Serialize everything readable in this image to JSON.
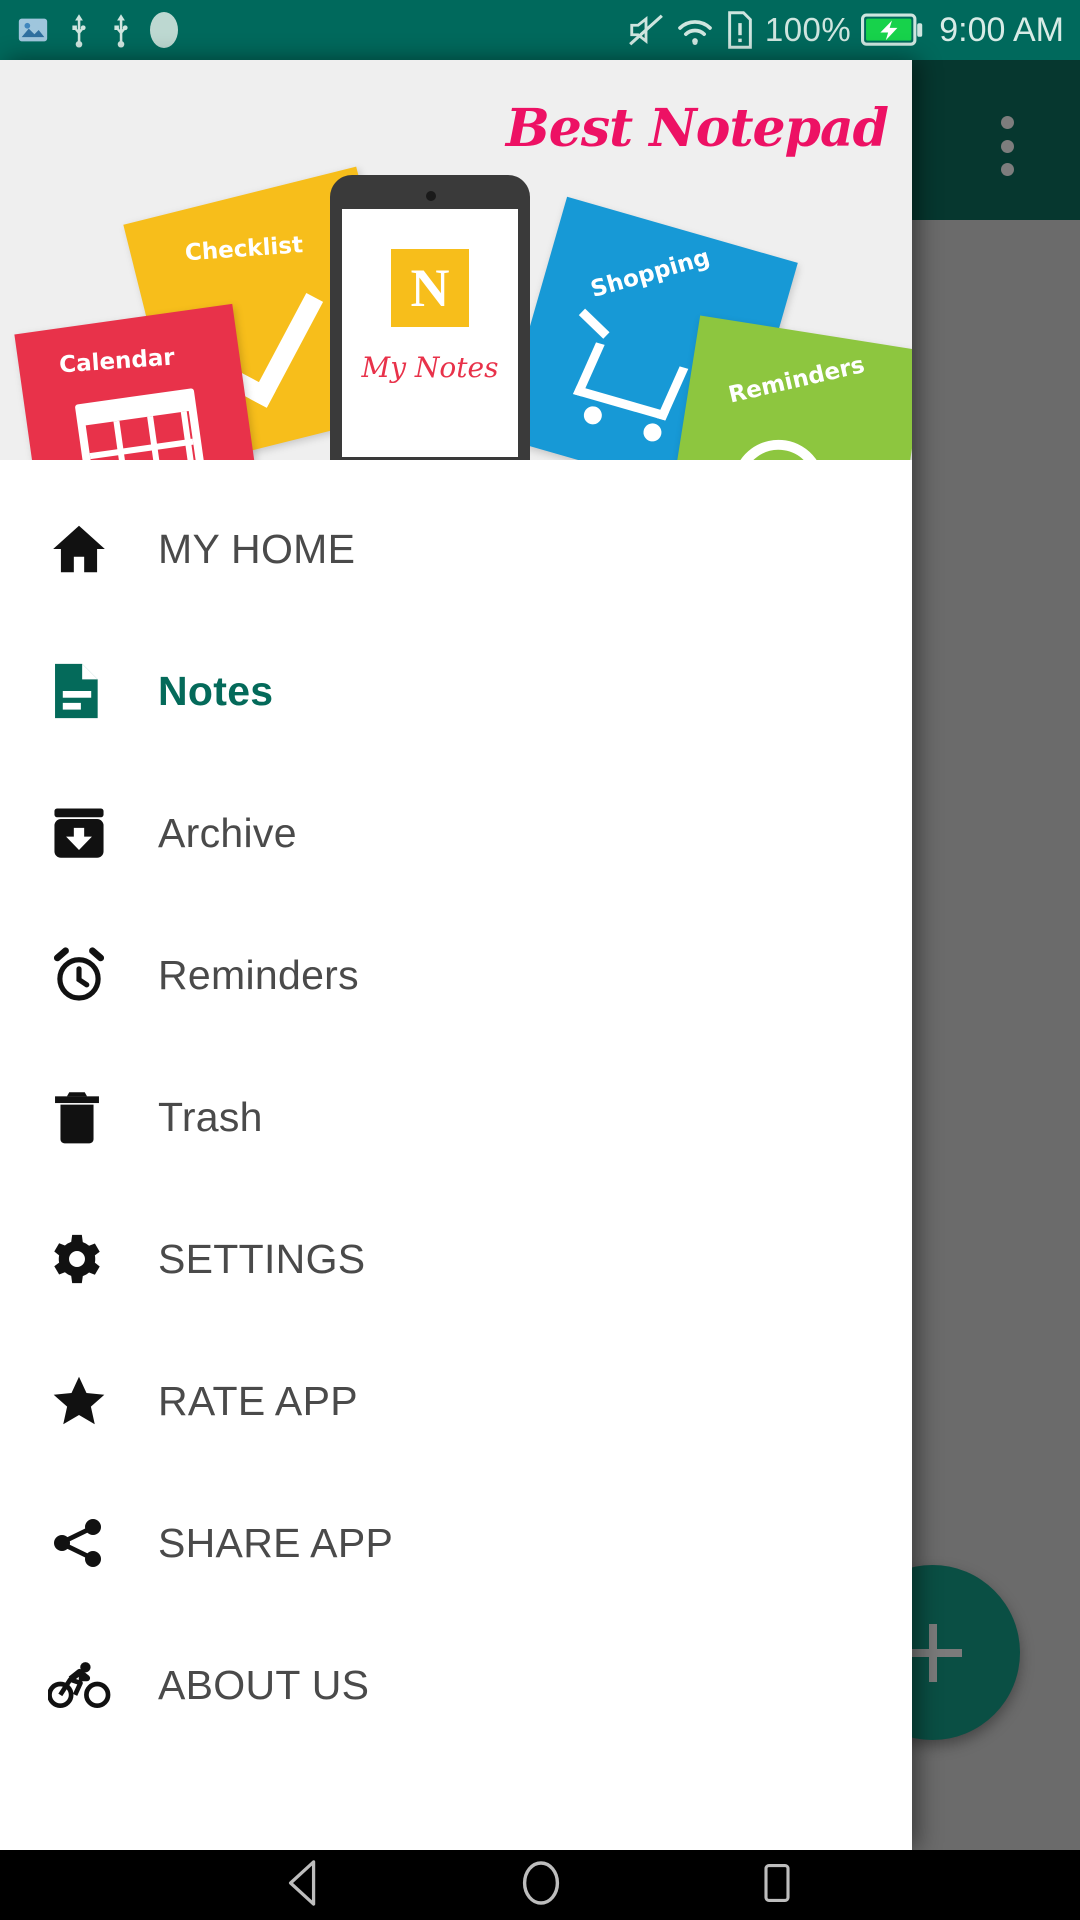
{
  "status_bar": {
    "icons": [
      "photo-icon",
      "usb-icon",
      "usb-icon",
      "dot-icon",
      "mute-icon",
      "wifi-icon",
      "sim-alert-icon"
    ],
    "battery_percent": "100%",
    "battery_state": "charging",
    "clock": "9:00 AM"
  },
  "toolbar": {
    "title": "",
    "overflow_label": "More options",
    "bg_color": "#06372F"
  },
  "fab": {
    "label": "+",
    "name": "add-note-fab",
    "color": "#0A4F44"
  },
  "drawer": {
    "header": {
      "banner_title": "Best Notepad",
      "phone_logo_letter": "N",
      "phone_brand": "My Notes",
      "stickies": [
        {
          "label": "Checklist",
          "color": "#F7BE1B",
          "icon": "check-icon"
        },
        {
          "label": "Calendar",
          "color": "#E8324A",
          "icon": "calendar-icon"
        },
        {
          "label": "Shopping",
          "color": "#1799D6",
          "icon": "shopping-cart-icon"
        },
        {
          "label": "Reminders",
          "color": "#8DC63F",
          "icon": "alarm-clock-icon"
        }
      ]
    },
    "items": [
      {
        "label": "MY HOME",
        "icon": "home-icon",
        "active": false
      },
      {
        "label": "Notes",
        "icon": "note-icon",
        "active": true
      },
      {
        "label": "Archive",
        "icon": "archive-icon",
        "active": false
      },
      {
        "label": "Reminders",
        "icon": "alarm-icon",
        "active": false
      },
      {
        "label": "Trash",
        "icon": "trash-icon",
        "active": false
      },
      {
        "label": "SETTINGS",
        "icon": "gear-icon",
        "active": false
      },
      {
        "label": "RATE APP",
        "icon": "star-icon",
        "active": false
      },
      {
        "label": "SHARE APP",
        "icon": "share-icon",
        "active": false
      },
      {
        "label": "ABOUT US",
        "icon": "bicycle-icon",
        "active": false
      }
    ],
    "accent_color": "#046A5A"
  },
  "nav_bar": {
    "back": "back-icon",
    "home": "home-circle-icon",
    "recents": "recents-icon"
  }
}
